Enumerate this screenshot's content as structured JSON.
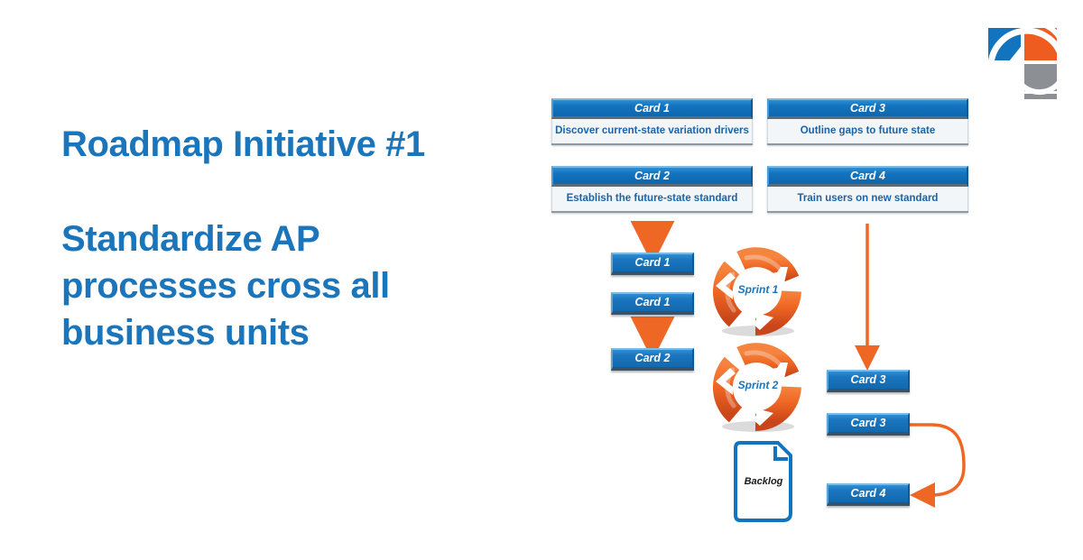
{
  "slide": {
    "title": "Roadmap Initiative #1",
    "subtitle": "Standardize AP processes cross all business units",
    "colors": {
      "brand_blue": "#1b75bb",
      "card_header_blue": "#1273be",
      "card_body_bg": "#f2f6f9",
      "card_body_text": "#1b63a8",
      "accent_orange": "#ef6724",
      "logo_blue": "#1b75bb",
      "logo_orange": "#ef6724",
      "logo_gray": "#8c8c8c"
    }
  },
  "logo": {
    "name": "company-logo",
    "blue_square": "#1273be",
    "orange_square": "#ef5c1f",
    "gray_square": "#8c9094",
    "gray_arc": "#8c9094"
  },
  "diagram": {
    "backlog": {
      "label": "Backlog"
    },
    "sprints": [
      {
        "label": "Sprint 1"
      },
      {
        "label": "Sprint 2"
      }
    ],
    "big_cards": [
      {
        "header": "Card 1",
        "body": "Discover current-state variation drivers"
      },
      {
        "header": "Card 2",
        "body": "Establish the future-state standard"
      },
      {
        "header": "Card 3",
        "body": "Outline gaps to future state"
      },
      {
        "header": "Card 4",
        "body": "Train users on new standard"
      }
    ],
    "sprint1_queue": [
      {
        "label": "Card 1"
      },
      {
        "label": "Card 1"
      },
      {
        "label": "Card 2"
      }
    ],
    "sprint2_queue": [
      {
        "label": "Card 3"
      },
      {
        "label": "Card 3"
      },
      {
        "label": "Card 4"
      }
    ]
  }
}
